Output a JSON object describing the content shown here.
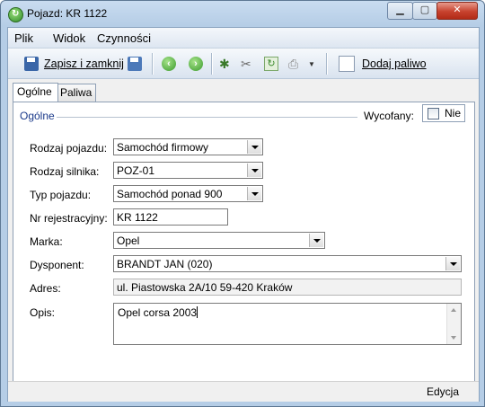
{
  "window": {
    "title": "Pojazd: KR 1122",
    "min_label": "▁",
    "max_label": "▢",
    "close_label": "✕"
  },
  "menu": {
    "items": [
      "Plik",
      "Widok",
      "Czynności"
    ]
  },
  "toolbar": {
    "save_close_label": "Zapisz i zamknij",
    "add_fuel_label": "Dodaj paliwo"
  },
  "tabs": [
    "Ogólne",
    "Paliwa"
  ],
  "general": {
    "group_title": "Ogólne",
    "retired": {
      "label": "Wycofany:",
      "checkbox_label": "Nie",
      "checked": false
    },
    "fields": {
      "vehicle_type": {
        "label": "Rodzaj pojazdu:",
        "value": "Samochód firmowy"
      },
      "engine_type": {
        "label": "Rodzaj silnika:",
        "value": "POZ-01"
      },
      "vehicle_model_type": {
        "label": "Typ pojazdu:",
        "value": "Samochód ponad 900"
      },
      "registration": {
        "label": "Nr rejestracyjny:",
        "value": "KR 1122"
      },
      "brand": {
        "label": "Marka:",
        "value": "Opel"
      },
      "dispatcher": {
        "label": "Dysponent:",
        "value": "BRANDT JAN (020)"
      },
      "address": {
        "label": "Adres:",
        "value": "ul. Piastowska 2A/10 59-420 Kraków"
      },
      "description": {
        "label": "Opis:",
        "value": "Opel corsa 2003"
      }
    }
  },
  "status": {
    "mode": "Edycja"
  }
}
